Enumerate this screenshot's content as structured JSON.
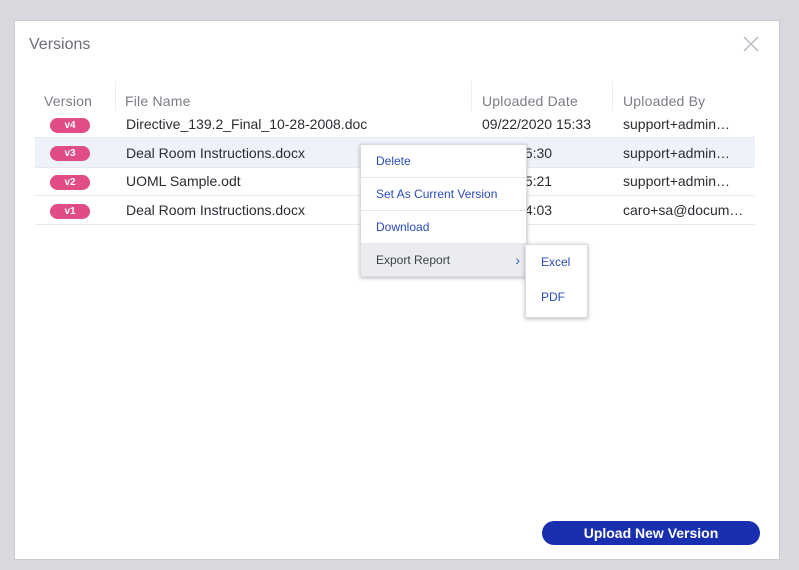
{
  "dialog": {
    "title": "Versions",
    "close_icon": "close-icon"
  },
  "table": {
    "headers": [
      "Version",
      "File Name",
      "Uploaded Date",
      "Uploaded By"
    ],
    "rows": [
      {
        "version": "v4",
        "file": "Directive_139.2_Final_10-28-2008.doc",
        "date": "09/22/2020 15:33",
        "user": "support+admin…"
      },
      {
        "version": "v3",
        "file": "Deal Room Instructions.docx",
        "date": "2020 15:30",
        "user": "support+admin…"
      },
      {
        "version": "v2",
        "file": "UOML Sample.odt",
        "date": "2020 15:21",
        "user": "support+admin…"
      },
      {
        "version": "v1",
        "file": "Deal Room Instructions.docx",
        "date": "2020 14:03",
        "user": "caro+sa@docum…"
      }
    ]
  },
  "context_menu": {
    "items": [
      "Delete",
      "Set As Current Version",
      "Download",
      "Export Report"
    ],
    "submenu": [
      "Excel",
      "PDF"
    ]
  },
  "footer": {
    "upload_label": "Upload New Version"
  },
  "colors": {
    "badge": "#e14b86",
    "primary_button": "#1a2fb0",
    "menu_link": "#2a4bb8"
  }
}
